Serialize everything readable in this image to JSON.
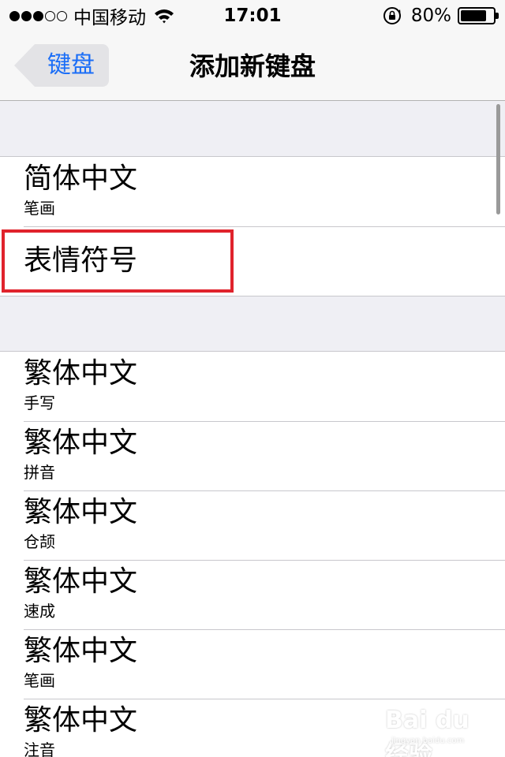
{
  "status_bar": {
    "signal_dots": [
      true,
      true,
      true,
      false,
      false
    ],
    "carrier": "中国移动",
    "wifi_icon": "wifi-icon",
    "time": "17:01",
    "orientation_lock_icon": "orientation-lock-icon",
    "battery_percent": "80%",
    "battery_level": 0.8
  },
  "nav": {
    "back_label": "键盘",
    "title": "添加新键盘"
  },
  "group1": [
    {
      "title": "简体中文",
      "subtitle": "笔画"
    },
    {
      "title": "表情符号",
      "subtitle": ""
    }
  ],
  "group2": [
    {
      "title": "繁体中文",
      "subtitle": "手写"
    },
    {
      "title": "繁体中文",
      "subtitle": "拼音"
    },
    {
      "title": "繁体中文",
      "subtitle": "仓颉"
    },
    {
      "title": "繁体中文",
      "subtitle": "速成"
    },
    {
      "title": "繁体中文",
      "subtitle": "笔画"
    },
    {
      "title": "繁体中文",
      "subtitle": "注音"
    }
  ],
  "watermark": {
    "text": "Bai du 经验",
    "sub": "jingyan.baidu.com"
  },
  "colors": {
    "accent": "#1b6ef7",
    "highlight_border": "#e0232c"
  }
}
